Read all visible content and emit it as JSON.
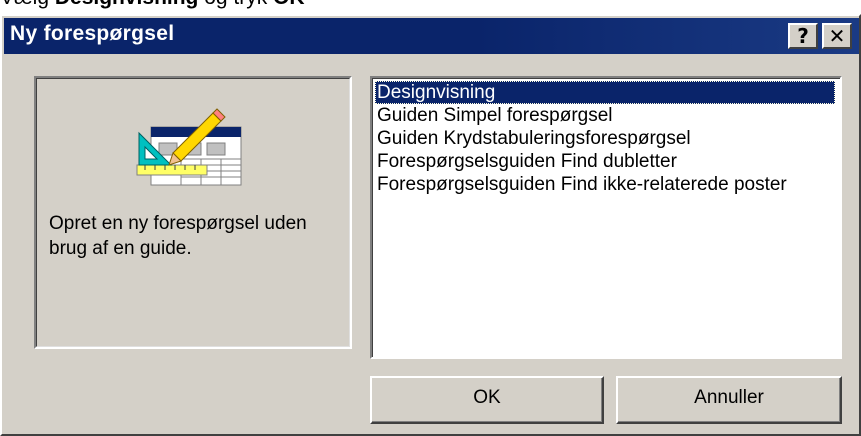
{
  "instruction": {
    "prefix": "Vælg ",
    "bold_choice": "Designvisning",
    "middle": " og tryk ",
    "bold_ok": "OK"
  },
  "dialog": {
    "title": "Ny forespørgsel",
    "help_label": "?",
    "close_label": "✕"
  },
  "description": "Opret en ny forespørgsel uden brug af en guide.",
  "list": {
    "items": [
      "Designvisning",
      "Guiden Simpel forespørgsel",
      "Guiden Krydstabuleringsforespørgsel",
      "Forespørgselsguiden Find dubletter",
      "Forespørgselsguiden Find ikke-relaterede poster"
    ],
    "selected": "Designvisning"
  },
  "buttons": {
    "ok": "OK",
    "cancel": "Annuller"
  },
  "colors": {
    "titlebar": "#0a246a",
    "face": "#d4d0c8",
    "selection": "#0a246a"
  }
}
